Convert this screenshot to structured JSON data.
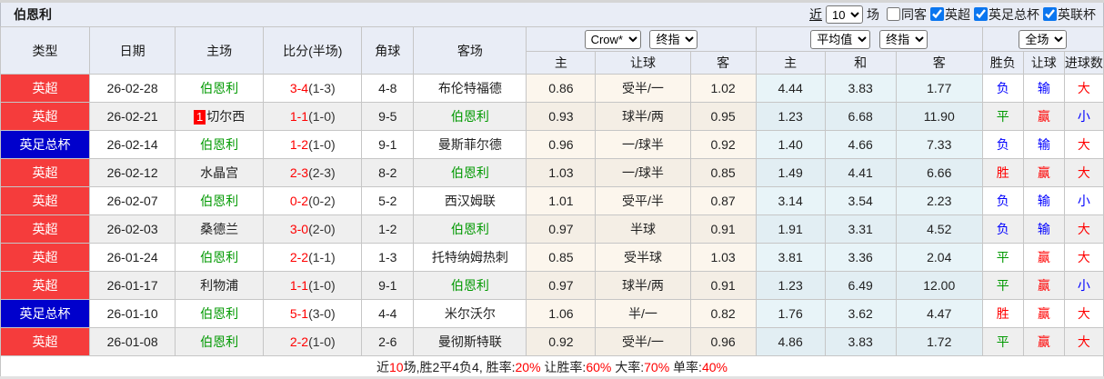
{
  "title": "伯恩利",
  "toolbar": {
    "near_label": "近",
    "near_count": "10",
    "matches_suffix": "场",
    "filters": [
      {
        "label": "同客",
        "checked": false
      },
      {
        "label": "英超",
        "checked": true
      },
      {
        "label": "英足总杯",
        "checked": true
      },
      {
        "label": "英联杯",
        "checked": true
      }
    ]
  },
  "header": {
    "base_cols": [
      "类型",
      "日期",
      "主场",
      "比分(半场)",
      "角球",
      "客场"
    ],
    "handicap_source_select": "Crow*",
    "handicap_kind_select": "终指",
    "europe_source_select": "平均值",
    "europe_kind_select": "终指",
    "result_scope_select": "全场",
    "handicap_cols": [
      "主",
      "让球",
      "客"
    ],
    "europe_cols": [
      "主",
      "和",
      "客"
    ],
    "result_cols": [
      "胜负",
      "让球",
      "进球数"
    ]
  },
  "rows": [
    {
      "league": "英超",
      "league_color": "red",
      "date": "26-02-28",
      "home": "伯恩利",
      "home_self": true,
      "home_card": "",
      "score": "3-4",
      "half": "(1-3)",
      "corner": "4-8",
      "away": "布伦特福德",
      "away_self": false,
      "hcp": {
        "home": "0.86",
        "line": "受半/一",
        "away": "1.02"
      },
      "eu": {
        "home": "4.44",
        "draw": "3.83",
        "away": "1.77"
      },
      "res": {
        "wdl": "负",
        "wdl_c": "blue",
        "hcp": "输",
        "hcp_c": "blue",
        "ou": "大",
        "ou_c": "red"
      }
    },
    {
      "league": "英超",
      "league_color": "red",
      "date": "26-02-21",
      "home": "切尔西",
      "home_self": false,
      "home_card": "1",
      "score": "1-1",
      "half": "(1-0)",
      "corner": "9-5",
      "away": "伯恩利",
      "away_self": true,
      "hcp": {
        "home": "0.93",
        "line": "球半/两",
        "away": "0.95"
      },
      "eu": {
        "home": "1.23",
        "draw": "6.68",
        "away": "11.90"
      },
      "res": {
        "wdl": "平",
        "wdl_c": "green",
        "hcp": "赢",
        "hcp_c": "red",
        "ou": "小",
        "ou_c": "blue"
      }
    },
    {
      "league": "英足总杯",
      "league_color": "blue",
      "date": "26-02-14",
      "home": "伯恩利",
      "home_self": true,
      "home_card": "",
      "score": "1-2",
      "half": "(1-0)",
      "corner": "9-1",
      "away": "曼斯菲尔德",
      "away_self": false,
      "hcp": {
        "home": "0.96",
        "line": "一/球半",
        "away": "0.92"
      },
      "eu": {
        "home": "1.40",
        "draw": "4.66",
        "away": "7.33"
      },
      "res": {
        "wdl": "负",
        "wdl_c": "blue",
        "hcp": "输",
        "hcp_c": "blue",
        "ou": "大",
        "ou_c": "red"
      }
    },
    {
      "league": "英超",
      "league_color": "red",
      "date": "26-02-12",
      "home": "水晶宫",
      "home_self": false,
      "home_card": "",
      "score": "2-3",
      "half": "(2-3)",
      "corner": "8-2",
      "away": "伯恩利",
      "away_self": true,
      "hcp": {
        "home": "1.03",
        "line": "一/球半",
        "away": "0.85"
      },
      "eu": {
        "home": "1.49",
        "draw": "4.41",
        "away": "6.66"
      },
      "res": {
        "wdl": "胜",
        "wdl_c": "red",
        "hcp": "赢",
        "hcp_c": "red",
        "ou": "大",
        "ou_c": "red"
      }
    },
    {
      "league": "英超",
      "league_color": "red",
      "date": "26-02-07",
      "home": "伯恩利",
      "home_self": true,
      "home_card": "",
      "score": "0-2",
      "half": "(0-2)",
      "corner": "5-2",
      "away": "西汉姆联",
      "away_self": false,
      "hcp": {
        "home": "1.01",
        "line": "受平/半",
        "away": "0.87"
      },
      "eu": {
        "home": "3.14",
        "draw": "3.54",
        "away": "2.23"
      },
      "res": {
        "wdl": "负",
        "wdl_c": "blue",
        "hcp": "输",
        "hcp_c": "blue",
        "ou": "小",
        "ou_c": "blue"
      }
    },
    {
      "league": "英超",
      "league_color": "red",
      "date": "26-02-03",
      "home": "桑德兰",
      "home_self": false,
      "home_card": "",
      "score": "3-0",
      "half": "(2-0)",
      "corner": "1-2",
      "away": "伯恩利",
      "away_self": true,
      "hcp": {
        "home": "0.97",
        "line": "半球",
        "away": "0.91"
      },
      "eu": {
        "home": "1.91",
        "draw": "3.31",
        "away": "4.52"
      },
      "res": {
        "wdl": "负",
        "wdl_c": "blue",
        "hcp": "输",
        "hcp_c": "blue",
        "ou": "大",
        "ou_c": "red"
      }
    },
    {
      "league": "英超",
      "league_color": "red",
      "date": "26-01-24",
      "home": "伯恩利",
      "home_self": true,
      "home_card": "",
      "score": "2-2",
      "half": "(1-1)",
      "corner": "1-3",
      "away": "托特纳姆热刺",
      "away_self": false,
      "hcp": {
        "home": "0.85",
        "line": "受半球",
        "away": "1.03"
      },
      "eu": {
        "home": "3.81",
        "draw": "3.36",
        "away": "2.04"
      },
      "res": {
        "wdl": "平",
        "wdl_c": "green",
        "hcp": "赢",
        "hcp_c": "red",
        "ou": "大",
        "ou_c": "red"
      }
    },
    {
      "league": "英超",
      "league_color": "red",
      "date": "26-01-17",
      "home": "利物浦",
      "home_self": false,
      "home_card": "",
      "score": "1-1",
      "half": "(1-0)",
      "corner": "9-1",
      "away": "伯恩利",
      "away_self": true,
      "hcp": {
        "home": "0.97",
        "line": "球半/两",
        "away": "0.91"
      },
      "eu": {
        "home": "1.23",
        "draw": "6.49",
        "away": "12.00"
      },
      "res": {
        "wdl": "平",
        "wdl_c": "green",
        "hcp": "赢",
        "hcp_c": "red",
        "ou": "小",
        "ou_c": "blue"
      }
    },
    {
      "league": "英足总杯",
      "league_color": "blue",
      "date": "26-01-10",
      "home": "伯恩利",
      "home_self": true,
      "home_card": "",
      "score": "5-1",
      "half": "(3-0)",
      "corner": "4-4",
      "away": "米尔沃尔",
      "away_self": false,
      "hcp": {
        "home": "1.06",
        "line": "半/一",
        "away": "0.82"
      },
      "eu": {
        "home": "1.76",
        "draw": "3.62",
        "away": "4.47"
      },
      "res": {
        "wdl": "胜",
        "wdl_c": "red",
        "hcp": "赢",
        "hcp_c": "red",
        "ou": "大",
        "ou_c": "red"
      }
    },
    {
      "league": "英超",
      "league_color": "red",
      "date": "26-01-08",
      "home": "伯恩利",
      "home_self": true,
      "home_card": "",
      "score": "2-2",
      "half": "(1-0)",
      "corner": "2-6",
      "away": "曼彻斯特联",
      "away_self": false,
      "hcp": {
        "home": "0.92",
        "line": "受半/一",
        "away": "0.96"
      },
      "eu": {
        "home": "4.86",
        "draw": "3.83",
        "away": "1.72"
      },
      "res": {
        "wdl": "平",
        "wdl_c": "green",
        "hcp": "赢",
        "hcp_c": "red",
        "ou": "大",
        "ou_c": "red"
      }
    }
  ],
  "summary": {
    "segments": [
      {
        "t": "近",
        "c": "black"
      },
      {
        "t": "10",
        "c": "red"
      },
      {
        "t": "场,胜2平4负4, 胜率:",
        "c": "black"
      },
      {
        "t": "20%",
        "c": "red"
      },
      {
        "t": " 让胜率:",
        "c": "black"
      },
      {
        "t": "60%",
        "c": "red"
      },
      {
        "t": " 大率:",
        "c": "black"
      },
      {
        "t": "70%",
        "c": "red"
      },
      {
        "t": " 单率:",
        "c": "black"
      },
      {
        "t": "40%",
        "c": "red"
      }
    ]
  },
  "colors": {
    "league_red": "#f53c3c",
    "league_blue": "#0000cc",
    "self_team_green": "#009900",
    "score_red": "#ff0000",
    "result_blue": "#0000ff",
    "header_bg": "#e9edf6",
    "handicap_tint": "#fcf6ed",
    "europe_tint": "#e8f4f8"
  }
}
